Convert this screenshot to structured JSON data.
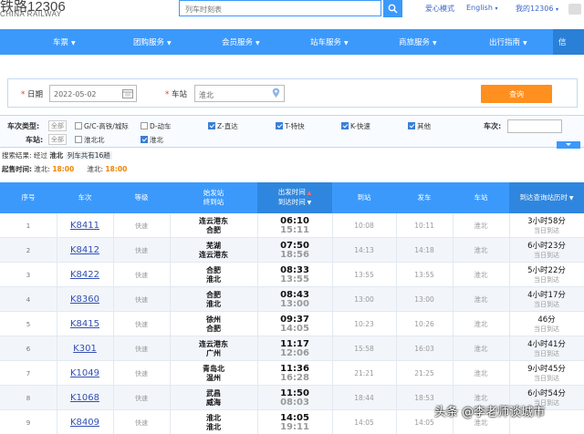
{
  "header": {
    "logo_text": "铁路12306",
    "logo_sub": "CHINA RAILWAY",
    "search_placeholder": "列车时刻表",
    "links": [
      "爱心模式",
      "English",
      "我的12306"
    ]
  },
  "nav": {
    "items": [
      "车票",
      "团购服务",
      "会员服务",
      "站车服务",
      "商旅服务",
      "出行指南",
      "信"
    ]
  },
  "query": {
    "date_label": "日期",
    "date_value": "2022-05-02",
    "station_label": "车站",
    "station_value": "淮北",
    "search_button": "查询"
  },
  "filters": {
    "type_label": "车次类型:",
    "all_label": "全部",
    "types": [
      {
        "label": "G/C-高铁/城际",
        "checked": false
      },
      {
        "label": "D-动车",
        "checked": false
      },
      {
        "label": "Z-直达",
        "checked": true
      },
      {
        "label": "T-特快",
        "checked": true
      },
      {
        "label": "K-快速",
        "checked": true
      },
      {
        "label": "其他",
        "checked": true
      }
    ],
    "trainno_label": "车次:",
    "station_label": "车站:",
    "stations": [
      {
        "label": "淮北北",
        "checked": false
      },
      {
        "label": "淮北",
        "checked": true
      }
    ]
  },
  "result": {
    "summary_prefix": "搜索结果:",
    "summary_via": "经过",
    "summary_station": "淮北",
    "summary_count": "列车共有16趟",
    "start_label": "起售时间:",
    "start_station1": "淮北:",
    "start_time1": "18:00",
    "start_station2": "淮北:",
    "start_time2": "18:00"
  },
  "table": {
    "headers": {
      "idx": "序号",
      "train": "车次",
      "grade": "等级",
      "stations": [
        "始发站",
        "终到站"
      ],
      "times": [
        "出发时间",
        "到达时间"
      ],
      "arrive": "到站",
      "depart": "发车",
      "station": "车站",
      "duration": "到达查询站历时"
    },
    "rows": [
      {
        "idx": "1",
        "train": "K8411",
        "grade": "快速",
        "from": "连云港东",
        "to": "合肥",
        "dep": "06:10",
        "arr": "15:11",
        "stop_arr": "10:08",
        "stop_dep": "10:11",
        "station": "淮北",
        "dur": "3小时58分",
        "day": "当日到达"
      },
      {
        "idx": "2",
        "train": "K8412",
        "grade": "快速",
        "from": "芜湖",
        "to": "连云港东",
        "dep": "07:50",
        "arr": "18:56",
        "stop_arr": "14:13",
        "stop_dep": "14:18",
        "station": "淮北",
        "dur": "6小时23分",
        "day": "当日到达"
      },
      {
        "idx": "3",
        "train": "K8422",
        "grade": "快速",
        "from": "合肥",
        "to": "淮北",
        "dep": "08:33",
        "arr": "13:55",
        "stop_arr": "13:55",
        "stop_dep": "13:55",
        "station": "淮北",
        "dur": "5小时22分",
        "day": "当日到达"
      },
      {
        "idx": "4",
        "train": "K8360",
        "grade": "快速",
        "from": "合肥",
        "to": "淮北",
        "dep": "08:43",
        "arr": "13:00",
        "stop_arr": "13:00",
        "stop_dep": "13:00",
        "station": "淮北",
        "dur": "4小时17分",
        "day": "当日到达"
      },
      {
        "idx": "5",
        "train": "K8415",
        "grade": "快速",
        "from": "徐州",
        "to": "合肥",
        "dep": "09:37",
        "arr": "14:05",
        "stop_arr": "10:23",
        "stop_dep": "10:26",
        "station": "淮北",
        "dur": "46分",
        "day": "当日到达"
      },
      {
        "idx": "6",
        "train": "K301",
        "grade": "快速",
        "from": "连云港东",
        "to": "广州",
        "dep": "11:17",
        "arr": "12:06",
        "stop_arr": "15:58",
        "stop_dep": "16:03",
        "station": "淮北",
        "dur": "4小时41分",
        "day": "当日到达"
      },
      {
        "idx": "7",
        "train": "K1049",
        "grade": "快速",
        "from": "青岛北",
        "to": "温州",
        "dep": "11:36",
        "arr": "16:28",
        "stop_arr": "21:21",
        "stop_dep": "21:25",
        "station": "淮北",
        "dur": "9小时45分",
        "day": "当日到达"
      },
      {
        "idx": "8",
        "train": "K1068",
        "grade": "快速",
        "from": "武昌",
        "to": "威海",
        "dep": "11:50",
        "arr": "08:03",
        "stop_arr": "18:44",
        "stop_dep": "18:53",
        "station": "淮北",
        "dur": "6小时54分",
        "day": "当日到达"
      },
      {
        "idx": "9",
        "train": "K8409",
        "grade": "快速",
        "from": "淮北",
        "to": "淮北",
        "dep": "14:05",
        "arr": "19:11",
        "stop_arr": "14:05",
        "stop_dep": "14:05",
        "station": "淮北",
        "dur": "",
        "day": ""
      }
    ]
  },
  "watermark": "头条 @李老师谈城市",
  "colors": {
    "nav_blue": "#3b99fc",
    "accent_orange": "#ff8f1f",
    "link_blue": "#334fb4"
  }
}
